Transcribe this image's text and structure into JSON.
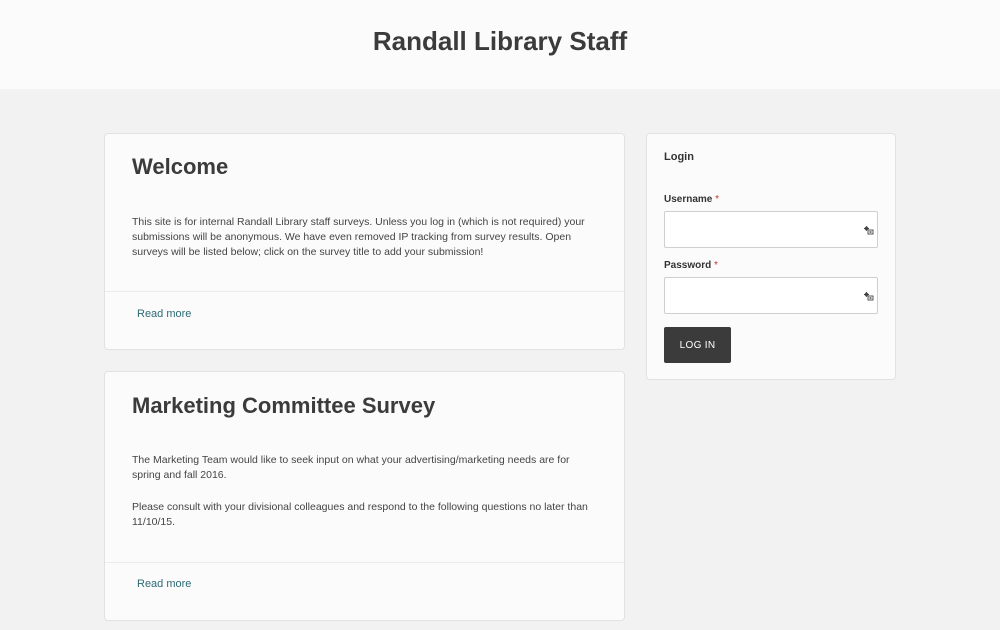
{
  "site": {
    "title": "Randall Library Staff"
  },
  "posts": [
    {
      "title": "Welcome",
      "paragraphs": [
        "This site is for internal Randall Library staff surveys. Unless you log in (which is not required) your submissions will be anonymous. We have even removed IP tracking from survey results. Open surveys will be listed below; click on the survey title to add your submission!"
      ],
      "read_more": "Read more"
    },
    {
      "title": "Marketing Committee Survey",
      "paragraphs": [
        "The Marketing Team would like to seek input on what your advertising/marketing needs are for spring and fall 2016.",
        "Please consult with your divisional colleagues and respond to the following questions no later than 11/10/15."
      ],
      "read_more": "Read more"
    }
  ],
  "login": {
    "title": "Login",
    "username_label": "Username",
    "password_label": "Password",
    "required_marker": "*",
    "username_value": "",
    "password_value": "",
    "button_label": "LOG IN",
    "field_icon": "key-icon"
  },
  "colors": {
    "page_background": "#f2f2f2",
    "header_background": "#fbfbfb",
    "link": "#2e6a73",
    "button": "#3b3b3b",
    "required": "#c0392b"
  }
}
